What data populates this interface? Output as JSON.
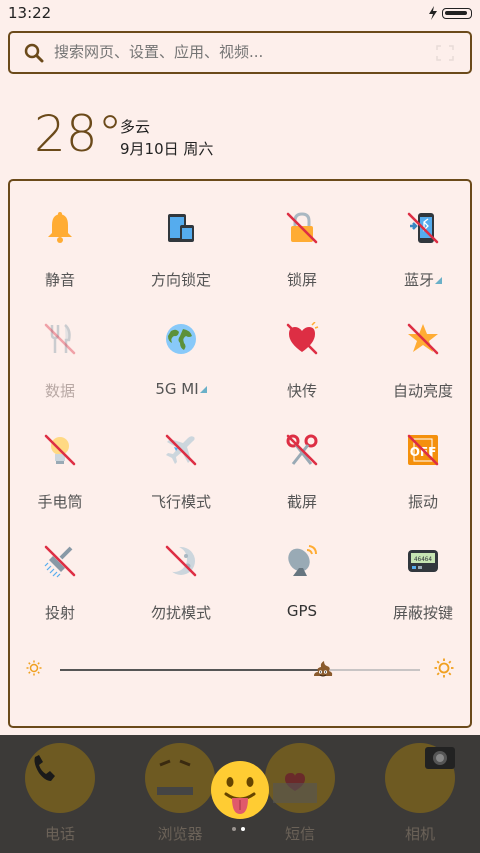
{
  "status_bar": {
    "time": "13:22",
    "battery_level": 0.9
  },
  "search": {
    "placeholder": "搜索网页、设置、应用、视频..."
  },
  "weather": {
    "temperature": "28°",
    "condition": "多云",
    "date": "9月10日 周六"
  },
  "quick_settings": {
    "tiles": [
      {
        "label": "静音",
        "icon": "bell-icon",
        "disabled": false,
        "has_menu": false
      },
      {
        "label": "方向锁定",
        "icon": "phone-rotation-lock-icon",
        "disabled": false,
        "has_menu": false
      },
      {
        "label": "锁屏",
        "icon": "lock-icon",
        "disabled": true,
        "has_menu": false
      },
      {
        "label": "蓝牙",
        "icon": "bluetooth-icon",
        "disabled": true,
        "has_menu": true
      },
      {
        "label": "数据",
        "icon": "fork-knife-icon",
        "disabled": true,
        "has_menu": false
      },
      {
        "label": "5G MI",
        "icon": "globe-icon",
        "disabled": false,
        "has_menu": true
      },
      {
        "label": "快传",
        "icon": "heart-icon",
        "disabled": true,
        "has_menu": false
      },
      {
        "label": "自动亮度",
        "icon": "star-icon",
        "disabled": true,
        "has_menu": false
      },
      {
        "label": "手电筒",
        "icon": "bulb-icon",
        "disabled": true,
        "has_menu": false
      },
      {
        "label": "飞行模式",
        "icon": "airplane-icon",
        "disabled": true,
        "has_menu": false
      },
      {
        "label": "截屏",
        "icon": "scissors-icon",
        "disabled": true,
        "has_menu": false
      },
      {
        "label": "振动",
        "icon": "vibrate-icon",
        "disabled": true,
        "has_menu": false
      },
      {
        "label": "投射",
        "icon": "shower-icon",
        "disabled": true,
        "has_menu": false
      },
      {
        "label": "勿扰模式",
        "icon": "moon-icon",
        "disabled": true,
        "has_menu": false
      },
      {
        "label": "GPS",
        "icon": "satellite-icon",
        "disabled": false,
        "has_menu": false
      },
      {
        "label": "屏蔽按键",
        "icon": "pager-icon",
        "disabled": false,
        "has_menu": false
      }
    ]
  },
  "brightness": {
    "value": 0.73,
    "min_icon": "sun-small-icon",
    "max_icon": "sun-large-icon",
    "thumb_icon": "poop-icon"
  },
  "dock": {
    "items": [
      {
        "label": "电话",
        "icon": "phone-icon"
      },
      {
        "label": "浏览器",
        "icon": "browser-icon"
      },
      {
        "label": "短信",
        "icon": "message-icon"
      },
      {
        "label": "相机",
        "icon": "camera-icon"
      }
    ],
    "center_icon": "tongue-face-icon",
    "page_count": 2,
    "active_page": 1
  },
  "colors": {
    "accent": "#6b4a1a",
    "background": "#fdefeb",
    "dock": "#3c3a38"
  }
}
